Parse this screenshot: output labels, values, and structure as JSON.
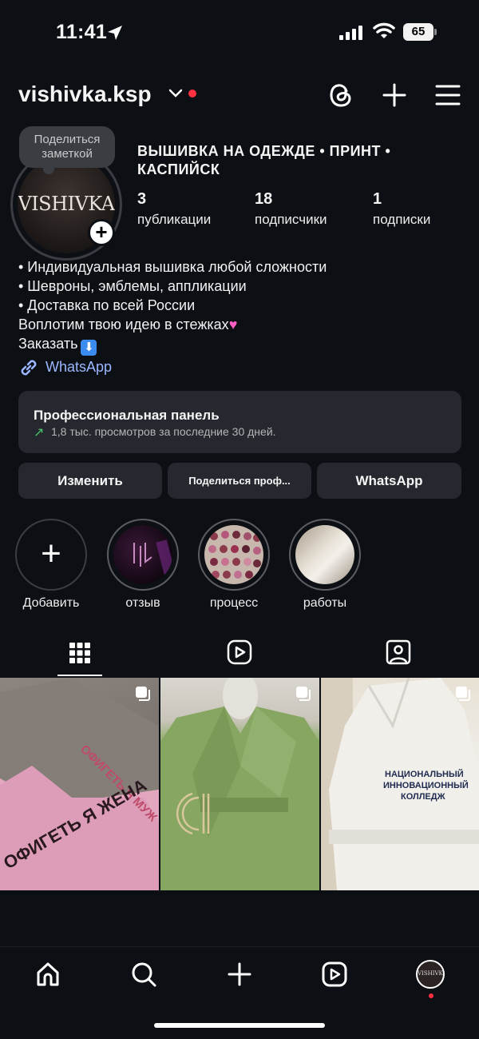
{
  "status_bar": {
    "time": "11:41",
    "battery": "65"
  },
  "header": {
    "username": "vishivka.ksp"
  },
  "profile": {
    "note_bubble": "Поделиться заметкой",
    "avatar_logo": "VISHIVKA",
    "full_name": "ВЫШИВКА НА ОДЕЖДЕ • ПРИНТ • КАСПИЙСК",
    "stats": [
      {
        "value": "3",
        "label": "публикации"
      },
      {
        "value": "18",
        "label": "подписчики"
      },
      {
        "value": "1",
        "label": "подписки"
      }
    ],
    "bio": [
      "• Индивидуальная вышивка любой сложности",
      "• Шевроны, эмблемы, аппликации",
      "• Доставка по всей России",
      "Воплотим твою идею в стежках",
      "Заказать"
    ],
    "link": "WhatsApp"
  },
  "pro_panel": {
    "title": "Профессиональная панель",
    "subtitle": "1,8 тыс. просмотров за последние 30 дней."
  },
  "buttons": {
    "edit": "Изменить",
    "share": "Поделиться проф...",
    "whatsapp": "WhatsApp"
  },
  "highlights": [
    {
      "label": "Добавить"
    },
    {
      "label": "отзыв"
    },
    {
      "label": "процесс"
    },
    {
      "label": "работы"
    }
  ],
  "posts": [
    {
      "text_top": "ОФИГЕТЬ Я МУЖ",
      "text_bottom": "ОФИГЕТЬ Я ЖЕНА"
    },
    {
      "text": ""
    },
    {
      "text": "НАЦИОНАЛЬНЫЙ ИННОВАЦИОННЫЙ КОЛЛЕДЖ"
    }
  ],
  "colors": {
    "background": "#0c0f14",
    "panel": "#25282e",
    "link": "#9bb7ff",
    "notification": "#ff3040"
  },
  "icons": [
    "location-arrow-icon",
    "signal-icon",
    "wifi-icon",
    "chevron-down-icon",
    "threads-icon",
    "plus-icon",
    "menu-icon",
    "link-icon",
    "grid-icon",
    "reels-icon",
    "tagged-icon",
    "home-icon",
    "search-icon"
  ]
}
